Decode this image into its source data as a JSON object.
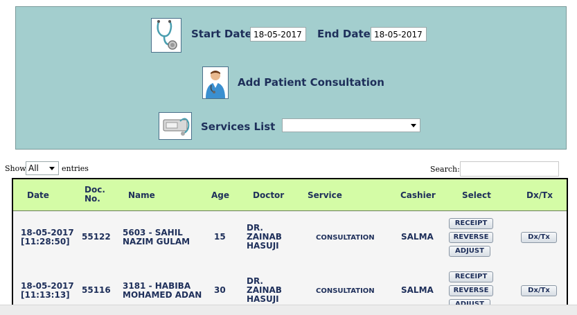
{
  "filters": {
    "start_date_label": "Start Date",
    "start_date_value": "18-05-2017",
    "end_date_label": "End Date",
    "end_date_value": "18-05-2017",
    "add_consultation_label": "Add Patient Consultation",
    "services_label": "Services List",
    "services_selected": ""
  },
  "table_controls": {
    "show_label": "Show",
    "page_length": "All",
    "entries_label": "entries",
    "search_label": "Search:",
    "search_value": ""
  },
  "table": {
    "headers": {
      "date": "Date",
      "doc_no_1": "Doc.",
      "doc_no_2": "No.",
      "name": "Name",
      "age": "Age",
      "doctor": "Doctor",
      "service": "Service",
      "cashier": "Cashier",
      "select": "Select",
      "dxtx": "Dx/Tx"
    },
    "rows": [
      {
        "date": "18-05-2017",
        "time": "[11:28:50]",
        "doc_no": "55122",
        "name_1": "5603 - SAHIL",
        "name_2": "NAZIM GULAM",
        "age": "15",
        "doctor_1": "DR.",
        "doctor_2": "ZAINAB",
        "doctor_3": "HASUJI",
        "service": "CONSULTATION",
        "cashier": "SALMA",
        "receipt": "RECEIPT",
        "reverse": "REVERSE",
        "adjust": "ADJUST",
        "dxtx": "Dx/Tx"
      },
      {
        "date": "18-05-2017",
        "time": "[11:13:13]",
        "doc_no": "55116",
        "name_1": "3181 - HABIBA",
        "name_2": "MOHAMED ADAN",
        "age": "30",
        "doctor_1": "DR.",
        "doctor_2": "ZAINAB",
        "doctor_3": "HASUJI",
        "service": "CONSULTATION",
        "cashier": "SALMA",
        "receipt": "RECEIPT",
        "reverse": "REVERSE",
        "adjust": "ADJUST",
        "dxtx": "Dx/Tx"
      }
    ]
  },
  "icons": {
    "start_date": "stethoscope-icon",
    "add_consultation": "doctor-icon",
    "services": "medical-equipment-icon"
  },
  "colors": {
    "panel_bg": "#a3cece",
    "header_bg": "#d4fca6",
    "label_text": "#1e2f5a"
  }
}
